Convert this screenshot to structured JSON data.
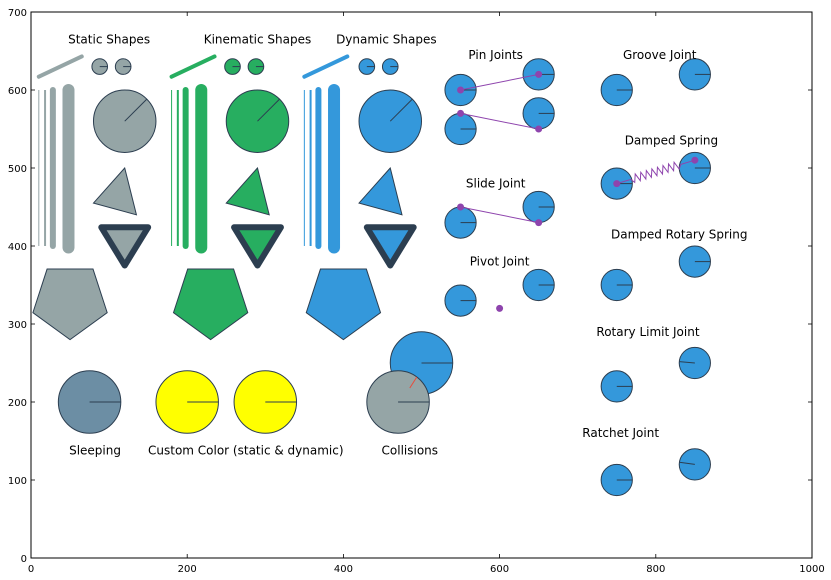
{
  "chart_data": {
    "type": "scatter",
    "title": "",
    "xlabel": "",
    "ylabel": "",
    "xlim": [
      0,
      1000
    ],
    "ylim": [
      0,
      700
    ],
    "grid": false,
    "legend": "none",
    "x_ticks": [
      0,
      200,
      400,
      600,
      800,
      1000
    ],
    "y_ticks": [
      0,
      100,
      200,
      300,
      400,
      500,
      600,
      700
    ],
    "colors": {
      "static": "#95a5a6",
      "kinematic": "#27ae60",
      "dynamic": "#3498db",
      "sleeping": "#6c8ea4",
      "custom": "#ffff00",
      "outline": "#2c3e50",
      "constraint": "#8e44ad",
      "collision": "#e74c3c"
    },
    "labels": [
      {
        "text": "Static Shapes",
        "x": 100,
        "y": 665
      },
      {
        "text": "Kinematic Shapes",
        "x": 290,
        "y": 665
      },
      {
        "text": "Dynamic Shapes",
        "x": 455,
        "y": 665
      },
      {
        "text": "Pin Joints",
        "x": 595,
        "y": 645
      },
      {
        "text": "Groove Joint",
        "x": 805,
        "y": 645
      },
      {
        "text": "Damped Spring",
        "x": 820,
        "y": 535
      },
      {
        "text": "Slide Joint",
        "x": 595,
        "y": 480
      },
      {
        "text": "Damped Rotary Spring",
        "x": 830,
        "y": 415
      },
      {
        "text": "Pivot Joint",
        "x": 600,
        "y": 380
      },
      {
        "text": "Rotary Limit Joint",
        "x": 790,
        "y": 290
      },
      {
        "text": "Ratchet Joint",
        "x": 755,
        "y": 160
      },
      {
        "text": "Sleeping",
        "x": 82,
        "y": 138
      },
      {
        "text": "Custom Color (static & dynamic)",
        "x": 275,
        "y": 138
      },
      {
        "text": "Collisions",
        "x": 485,
        "y": 138
      }
    ],
    "shape_groups": [
      {
        "name": "static",
        "color_key": "static",
        "segment": {
          "from": [
            10,
            617
          ],
          "to": [
            65,
            643
          ]
        },
        "small_circles": [
          {
            "x": 88,
            "y": 630,
            "r": 10
          },
          {
            "x": 118,
            "y": 630,
            "r": 10
          }
        ],
        "bars": [
          {
            "x": 10,
            "y0": 400,
            "y1": 600,
            "w": 1
          },
          {
            "x": 18,
            "y0": 400,
            "y1": 600,
            "w": 2
          },
          {
            "x": 28,
            "y0": 400,
            "y1": 600,
            "w": 6
          },
          {
            "x": 48,
            "y0": 398,
            "y1": 600,
            "w": 12
          }
        ],
        "big_circle": {
          "x": 120,
          "y": 560,
          "r": 40,
          "angle": 45
        },
        "triangle": [
          [
            120,
            500
          ],
          [
            80,
            455
          ],
          [
            135,
            440
          ]
        ],
        "inv_triangle": [
          [
            90,
            424
          ],
          [
            150,
            424
          ],
          [
            120,
            375
          ]
        ],
        "pentagon": {
          "cx": 50,
          "cy": 330,
          "r": 50
        }
      },
      {
        "name": "kinematic",
        "color_key": "kinematic",
        "segment": {
          "from": [
            180,
            617
          ],
          "to": [
            235,
            643
          ]
        },
        "small_circles": [
          {
            "x": 258,
            "y": 630,
            "r": 10
          },
          {
            "x": 288,
            "y": 630,
            "r": 10
          }
        ],
        "bars": [
          {
            "x": 180,
            "y0": 400,
            "y1": 600,
            "w": 1
          },
          {
            "x": 188,
            "y0": 400,
            "y1": 600,
            "w": 2
          },
          {
            "x": 198,
            "y0": 400,
            "y1": 600,
            "w": 6
          },
          {
            "x": 218,
            "y0": 398,
            "y1": 600,
            "w": 12
          }
        ],
        "big_circle": {
          "x": 290,
          "y": 560,
          "r": 40,
          "angle": 45
        },
        "triangle": [
          [
            290,
            500
          ],
          [
            250,
            455
          ],
          [
            305,
            440
          ]
        ],
        "inv_triangle": [
          [
            260,
            424
          ],
          [
            320,
            424
          ],
          [
            290,
            375
          ]
        ],
        "pentagon": {
          "cx": 230,
          "cy": 330,
          "r": 50
        }
      },
      {
        "name": "dynamic",
        "color_key": "dynamic",
        "segment": {
          "from": [
            350,
            617
          ],
          "to": [
            405,
            643
          ]
        },
        "small_circles": [
          {
            "x": 430,
            "y": 630,
            "r": 10
          },
          {
            "x": 460,
            "y": 630,
            "r": 10
          }
        ],
        "bars": [
          {
            "x": 350,
            "y0": 400,
            "y1": 600,
            "w": 1
          },
          {
            "x": 358,
            "y0": 400,
            "y1": 600,
            "w": 2
          },
          {
            "x": 368,
            "y0": 400,
            "y1": 600,
            "w": 6
          },
          {
            "x": 388,
            "y0": 398,
            "y1": 600,
            "w": 12
          }
        ],
        "big_circle": {
          "x": 460,
          "y": 560,
          "r": 40,
          "angle": 45
        },
        "triangle": [
          [
            460,
            500
          ],
          [
            420,
            455
          ],
          [
            475,
            440
          ]
        ],
        "inv_triangle": [
          [
            430,
            424
          ],
          [
            490,
            424
          ],
          [
            460,
            375
          ]
        ],
        "pentagon": {
          "cx": 400,
          "cy": 330,
          "r": 50
        }
      }
    ],
    "bodies": [
      {
        "name": "sleeping-ball",
        "x": 75,
        "y": 200,
        "r": 40,
        "angle": 0,
        "color_key": "sleeping"
      },
      {
        "name": "custom-static-ball",
        "x": 200,
        "y": 200,
        "r": 40,
        "angle": 0,
        "color_key": "custom"
      },
      {
        "name": "custom-dynamic-ball",
        "x": 300,
        "y": 200,
        "r": 40,
        "angle": 0,
        "color_key": "custom"
      },
      {
        "name": "collision-dynamic-ball",
        "x": 500,
        "y": 250,
        "r": 40,
        "angle": 0,
        "color_key": "dynamic"
      },
      {
        "name": "collision-static-ball",
        "x": 470,
        "y": 200,
        "r": 40,
        "angle": 0,
        "color_key": "static"
      },
      {
        "name": "pin-ball-a1",
        "x": 550,
        "y": 600,
        "r": 20,
        "angle": 0,
        "color_key": "dynamic"
      },
      {
        "name": "pin-ball-a2",
        "x": 650,
        "y": 620,
        "r": 20,
        "angle": 0,
        "color_key": "dynamic"
      },
      {
        "name": "pin-ball-b1",
        "x": 550,
        "y": 550,
        "r": 20,
        "angle": 0,
        "color_key": "dynamic"
      },
      {
        "name": "pin-ball-b2",
        "x": 650,
        "y": 570,
        "r": 20,
        "angle": 0,
        "color_key": "dynamic"
      },
      {
        "name": "slide-ball-1",
        "x": 550,
        "y": 430,
        "r": 20,
        "angle": 0,
        "color_key": "dynamic"
      },
      {
        "name": "slide-ball-2",
        "x": 650,
        "y": 450,
        "r": 20,
        "angle": 0,
        "color_key": "dynamic"
      },
      {
        "name": "pivot-ball-1",
        "x": 550,
        "y": 330,
        "r": 20,
        "angle": 0,
        "color_key": "dynamic"
      },
      {
        "name": "pivot-ball-2",
        "x": 650,
        "y": 350,
        "r": 20,
        "angle": 0,
        "color_key": "dynamic"
      },
      {
        "name": "groove-ball-1",
        "x": 750,
        "y": 600,
        "r": 20,
        "angle": 0,
        "color_key": "dynamic"
      },
      {
        "name": "groove-ball-2",
        "x": 850,
        "y": 620,
        "r": 20,
        "angle": 0,
        "color_key": "dynamic"
      },
      {
        "name": "spring-ball-1",
        "x": 750,
        "y": 480,
        "r": 20,
        "angle": 0,
        "color_key": "dynamic"
      },
      {
        "name": "spring-ball-2",
        "x": 850,
        "y": 500,
        "r": 20,
        "angle": 0,
        "color_key": "dynamic"
      },
      {
        "name": "rotary-spring-ball-1",
        "x": 750,
        "y": 350,
        "r": 20,
        "angle": 0,
        "color_key": "dynamic"
      },
      {
        "name": "rotary-spring-ball-2",
        "x": 850,
        "y": 380,
        "r": 20,
        "angle": 0,
        "color_key": "dynamic"
      },
      {
        "name": "rotary-limit-ball-1",
        "x": 750,
        "y": 220,
        "r": 20,
        "angle": 0,
        "color_key": "dynamic"
      },
      {
        "name": "rotary-limit-ball-2",
        "x": 850,
        "y": 250,
        "r": 20,
        "angle": 175,
        "color_key": "dynamic"
      },
      {
        "name": "ratchet-ball-1",
        "x": 750,
        "y": 100,
        "r": 20,
        "angle": 0,
        "color_key": "dynamic"
      },
      {
        "name": "ratchet-ball-2",
        "x": 850,
        "y": 120,
        "r": 20,
        "angle": 172,
        "color_key": "dynamic"
      }
    ],
    "constraint_lines": [
      {
        "name": "pin-joint-a",
        "from": [
          550,
          600
        ],
        "to": [
          650,
          620
        ]
      },
      {
        "name": "pin-joint-b",
        "from": [
          550,
          570
        ],
        "to": [
          650,
          550
        ]
      },
      {
        "name": "slide-joint",
        "from": [
          550,
          450
        ],
        "to": [
          650,
          430
        ]
      }
    ],
    "constraint_points": [
      [
        550,
        600
      ],
      [
        650,
        620
      ],
      [
        550,
        570
      ],
      [
        650,
        550
      ],
      [
        550,
        450
      ],
      [
        650,
        430
      ],
      [
        600,
        320
      ],
      [
        750,
        480
      ],
      [
        850,
        510
      ]
    ],
    "springs": [
      {
        "name": "damped-spring",
        "from": [
          750,
          480
        ],
        "to": [
          850,
          510
        ],
        "coils": 9
      }
    ],
    "collision_marker": {
      "from": [
        485,
        218
      ],
      "to": [
        494,
        232
      ]
    }
  }
}
